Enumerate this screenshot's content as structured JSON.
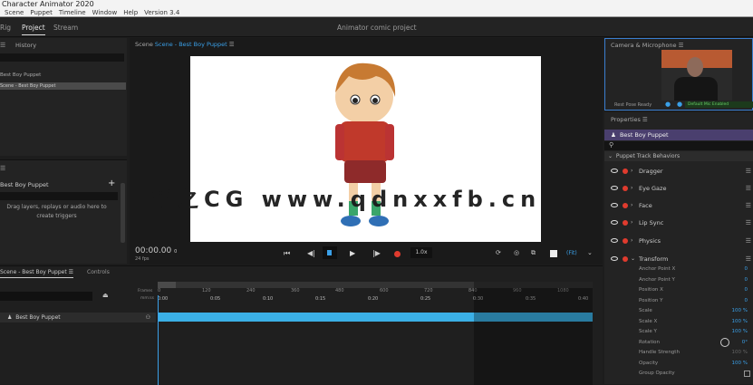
{
  "app": {
    "title": "Character Animator 2020",
    "menu": [
      "Scene",
      "Puppet",
      "Timeline",
      "Window",
      "Help",
      "Version 3.4"
    ]
  },
  "workspace": {
    "tabs": [
      "Rig",
      "Project",
      "Stream"
    ],
    "active": "Project",
    "project_name": "Animator comic project"
  },
  "left": {
    "tab": "History",
    "items": [
      "Best Boy Puppet",
      "Scene - Best Boy Puppet"
    ],
    "triggers_title": "Best Boy Puppet",
    "triggers_hint": "Drag layers, replays or audio here to create triggers",
    "add_icon": "plus-icon"
  },
  "scene": {
    "label": "Scene",
    "name": "Scene - Best Boy Puppet",
    "time": "00:00.00",
    "time_suffix": "0",
    "fps": "24 fps",
    "speed": "1.0x",
    "zoom": "(Fit)",
    "controls": [
      "go-to-start-icon",
      "step-back-icon",
      "stop-icon",
      "play-icon",
      "step-forward-icon",
      "record-icon"
    ]
  },
  "watermark": "青之CG www.qdnxxfb.cn",
  "camera": {
    "title": "Camera & Microphone",
    "status": "Rest Pose Ready",
    "audio": "Default Mic Enabled"
  },
  "properties": {
    "title": "Properties",
    "puppet": "Best Boy Puppet",
    "section": "Puppet Track Behaviors",
    "behaviors": [
      {
        "name": "Dragger",
        "expanded": false
      },
      {
        "name": "Eye Gaze",
        "expanded": false
      },
      {
        "name": "Face",
        "expanded": false
      },
      {
        "name": "Lip Sync",
        "expanded": false
      },
      {
        "name": "Physics",
        "expanded": false
      },
      {
        "name": "Transform",
        "expanded": true
      }
    ],
    "transform": [
      {
        "name": "Anchor Point X",
        "value": "0"
      },
      {
        "name": "Anchor Point Y",
        "value": "0"
      },
      {
        "name": "Position X",
        "value": "0"
      },
      {
        "name": "Position Y",
        "value": "0"
      },
      {
        "name": "Scale",
        "value": "100 %"
      },
      {
        "name": "Scale X",
        "value": "100 %"
      },
      {
        "name": "Scale Y",
        "value": "100 %"
      },
      {
        "name": "Rotation",
        "value": "0°"
      },
      {
        "name": "Handle Strength",
        "value": "100 %"
      },
      {
        "name": "Opacity",
        "value": "100 %"
      },
      {
        "name": "Group Opacity",
        "value": ""
      }
    ]
  },
  "timeline": {
    "tab": "Scene - Best Boy Puppet",
    "tab2": "Controls",
    "frames_label": "Frames",
    "time_label": "mm:ss",
    "frame_ticks": [
      "0",
      "120",
      "240",
      "360",
      "480",
      "600",
      "720",
      "840",
      "960",
      "1080"
    ],
    "time_ticks": [
      "0:00",
      "0:05",
      "0:10",
      "0:15",
      "0:20",
      "0:25",
      "0:30",
      "0:35",
      "0:40"
    ],
    "track": "Best Boy Puppet"
  },
  "colors": {
    "accent": "#3aa0e8",
    "track": "#3bb0e6",
    "record": "#e03b2e",
    "puppet_bar": "#4a3f6e"
  }
}
